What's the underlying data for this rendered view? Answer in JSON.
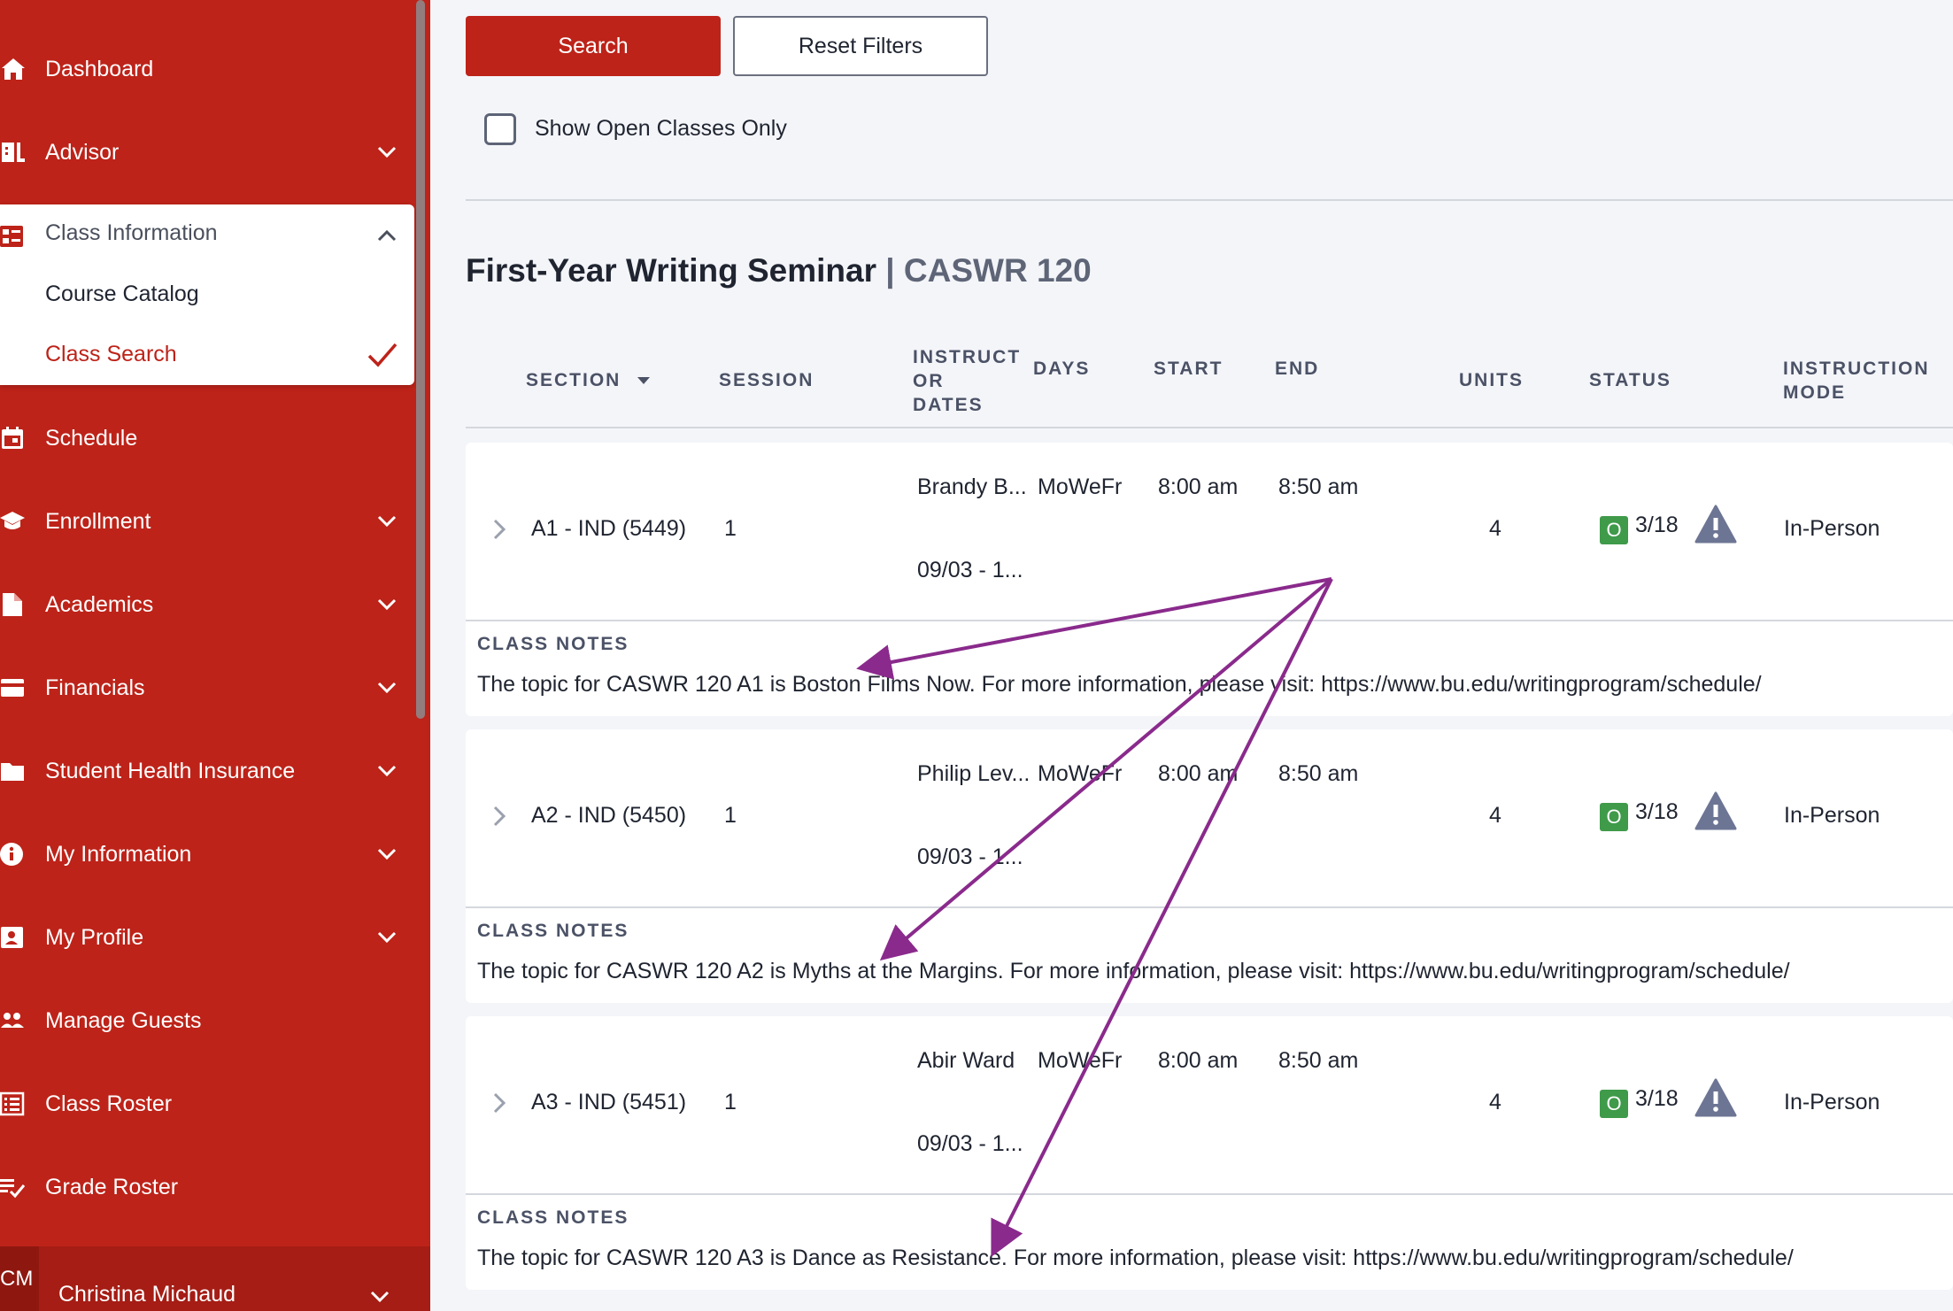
{
  "sidebar": {
    "items": [
      {
        "label": "Dashboard",
        "icon": "home-icon",
        "has_chevron": false
      },
      {
        "label": "Advisor",
        "icon": "advisor-icon",
        "has_chevron": true
      },
      {
        "label": "Schedule",
        "icon": "calendar-icon",
        "has_chevron": false
      },
      {
        "label": "Enrollment",
        "icon": "graduation-cap-icon",
        "has_chevron": true
      },
      {
        "label": "Academics",
        "icon": "document-icon",
        "has_chevron": true
      },
      {
        "label": "Financials",
        "icon": "credit-card-icon",
        "has_chevron": true
      },
      {
        "label": "Student Health Insurance",
        "icon": "folder-icon",
        "has_chevron": true
      },
      {
        "label": "My Information",
        "icon": "info-icon",
        "has_chevron": true
      },
      {
        "label": "My Profile",
        "icon": "id-card-icon",
        "has_chevron": true
      },
      {
        "label": "Manage Guests",
        "icon": "users-icon",
        "has_chevron": false
      },
      {
        "label": "Class Roster",
        "icon": "list-icon",
        "has_chevron": false
      },
      {
        "label": "Grade Roster",
        "icon": "checklist-icon",
        "has_chevron": false
      }
    ],
    "class_information": {
      "label": "Class Information",
      "icon": "class-info-icon",
      "children": [
        "Course Catalog",
        "Class Search"
      ],
      "selected": "Class Search"
    },
    "user": {
      "initials": "CM",
      "name": "Christina Michaud"
    },
    "color": "#bd2319"
  },
  "filters": {
    "search_label": "Search",
    "reset_label": "Reset Filters",
    "open_only_label": "Show Open Classes Only",
    "open_only_checked": false
  },
  "course": {
    "title": "First-Year Writing Seminar",
    "separator": "|",
    "code": "CASWR 120"
  },
  "table": {
    "headers": {
      "section": "SECTION",
      "session": "SESSION",
      "instructor_l1": "INSTRUCT",
      "instructor_l2": "OR",
      "instructor_l3": "DATES",
      "days": "DAYS",
      "start": "START",
      "end": "END",
      "units": "UNITS",
      "status": "STATUS",
      "mode_l1": "INSTRUCTION",
      "mode_l2": "MODE"
    },
    "notes_label": "CLASS NOTES",
    "rows": [
      {
        "section": "A1 - IND (5449)",
        "session": "1",
        "instructor": "Brandy B...",
        "dates": "09/03 - 1...",
        "days": "MoWeFr",
        "start": "8:00 am",
        "end": "8:50 am",
        "units": "4",
        "status_badge": "O",
        "seats": "3/18",
        "mode": "In-Person",
        "notes": "The topic for CASWR 120 A1 is Boston Films Now. For more information, please visit: https://www.bu.edu/writingprogram/schedule/"
      },
      {
        "section": "A2 - IND (5450)",
        "session": "1",
        "instructor": "Philip Lev...",
        "dates": "09/03 - 1...",
        "days": "MoWeFr",
        "start": "8:00 am",
        "end": "8:50 am",
        "units": "4",
        "status_badge": "O",
        "seats": "3/18",
        "mode": "In-Person",
        "notes": "The topic for CASWR 120 A2 is Myths at the Margins. For more information, please visit: https://www.bu.edu/writingprogram/schedule/"
      },
      {
        "section": "A3 - IND (5451)",
        "session": "1",
        "instructor": "Abir Ward",
        "dates": "09/03 - 1...",
        "days": "MoWeFr",
        "start": "8:00 am",
        "end": "8:50 am",
        "units": "4",
        "status_badge": "O",
        "seats": "3/18",
        "mode": "In-Person",
        "notes": "The topic for CASWR 120 A3 is Dance as Resistance. For more information, please visit: https://www.bu.edu/writingprogram/schedule/"
      }
    ]
  },
  "annotation_color": "#8a2a8c",
  "status_open_color": "#3f9a4a"
}
